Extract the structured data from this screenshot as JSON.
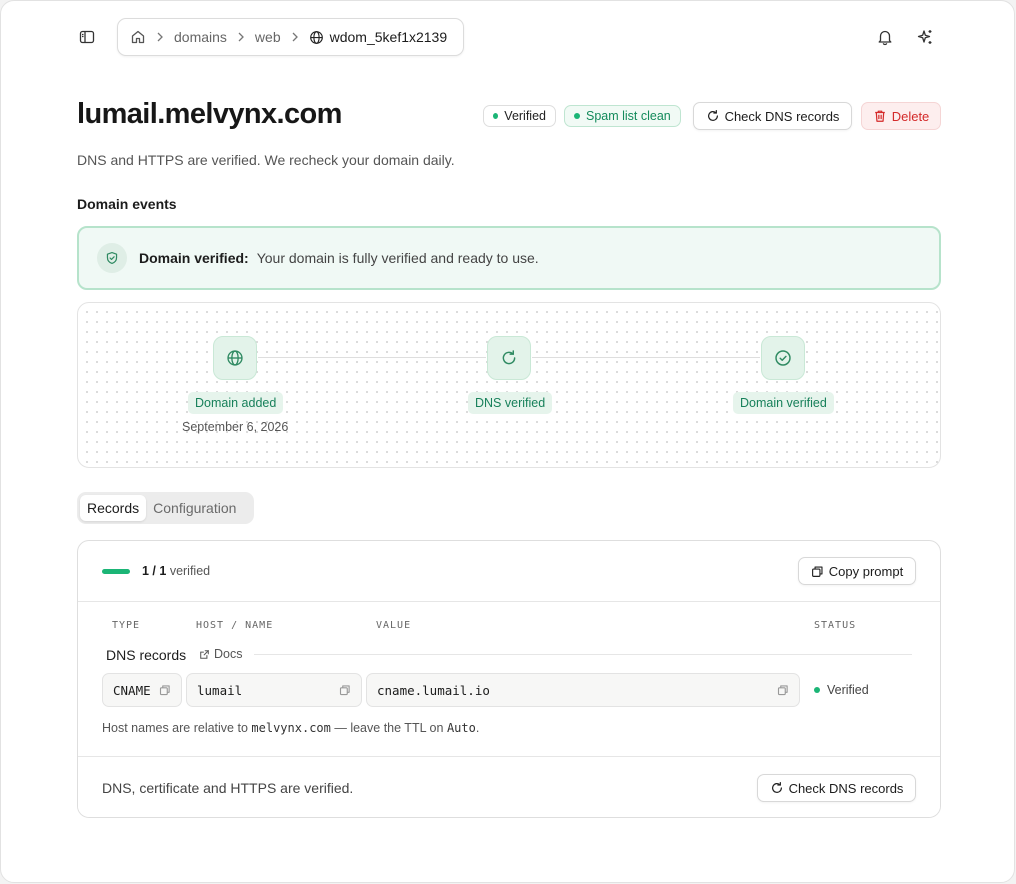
{
  "breadcrumb": {
    "items": [
      "domains",
      "web"
    ],
    "current": "wdom_5kef1x2139"
  },
  "header": {
    "title": "lumail.melvynx.com",
    "badge_verified": "Verified",
    "badge_spam": "Spam list clean",
    "check_dns_label": "Check DNS records",
    "delete_label": "Delete",
    "subtitle": "DNS and HTTPS are verified. We recheck your domain daily."
  },
  "events": {
    "section_title": "Domain events",
    "alert_title": "Domain verified:",
    "alert_text": "Your domain is fully verified and ready to use.",
    "steps": [
      {
        "label": "Domain added",
        "date": "September 6, 2026"
      },
      {
        "label": "DNS verified",
        "date": ""
      },
      {
        "label": "Domain verified",
        "date": ""
      }
    ]
  },
  "tabs": [
    {
      "label": "Records",
      "active": true
    },
    {
      "label": "Configuration",
      "active": false
    }
  ],
  "records": {
    "progress_count": "1 / 1",
    "progress_suffix": "verified",
    "progress_fraction": 1,
    "copy_prompt_label": "Copy prompt",
    "columns": {
      "type": "TYPE",
      "host": "HOST / NAME",
      "value": "VALUE",
      "status": "STATUS"
    },
    "group_title": "DNS records",
    "docs_label": "Docs",
    "rows": [
      {
        "type": "CNAME",
        "host": "lumail",
        "value": "cname.lumail.io",
        "status": "Verified"
      }
    ],
    "hint_prefix": "Host names are relative to",
    "hint_domain": "melvynx.com",
    "hint_middle": "— leave the TTL on",
    "hint_ttl": "Auto",
    "hint_suffix": ".",
    "footer_text": "DNS, certificate and HTTPS are verified.",
    "footer_check_label": "Check DNS records"
  },
  "colors": {
    "accent_green": "#1bb576",
    "danger": "#d42a2a"
  },
  "icons": {
    "sidebar": "sidebar-toggle-icon",
    "home": "home-icon",
    "globe": "globe-icon",
    "bell": "bell-icon",
    "sparkle": "sparkle-icon",
    "refresh": "refresh-icon",
    "trash": "trash-icon",
    "shield": "shield-check-icon",
    "copy": "copy-icon",
    "external": "external-link-icon"
  }
}
